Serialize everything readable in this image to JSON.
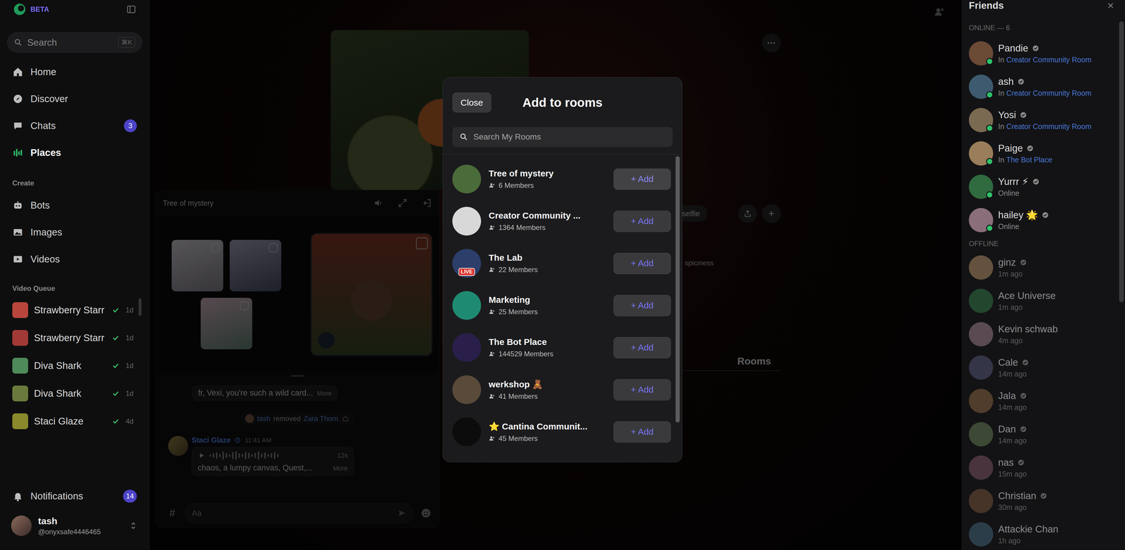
{
  "sidebar": {
    "badge": "BETA",
    "search": {
      "placeholder": "Search",
      "shortcut": "⌘K"
    },
    "nav": [
      {
        "label": "Home",
        "kind": "home",
        "selected": false
      },
      {
        "label": "Discover",
        "kind": "discover",
        "selected": false
      },
      {
        "label": "Chats",
        "kind": "chats",
        "selected": false,
        "count": "3"
      },
      {
        "label": "Places",
        "kind": "places",
        "selected": true
      }
    ],
    "create_title": "Create",
    "create": [
      {
        "label": "Bots",
        "kind": "bots"
      },
      {
        "label": "Images",
        "kind": "images"
      },
      {
        "label": "Videos",
        "kind": "videos"
      }
    ],
    "queue_title": "Video Queue",
    "queue": [
      {
        "name": "Strawberry Starr",
        "done": true,
        "age": "1d",
        "color": "#b8463c"
      },
      {
        "name": "Strawberry Starr",
        "done": true,
        "age": "1d",
        "color": "#a13a36"
      },
      {
        "name": "Diva Shark",
        "done": true,
        "age": "1d",
        "color": "#4f8a5a"
      },
      {
        "name": "Diva Shark",
        "done": true,
        "age": "1d",
        "color": "#6a7a3c"
      },
      {
        "name": "Staci Glaze",
        "done": true,
        "age": "4d",
        "color": "#8a8a2c"
      }
    ],
    "notifications": {
      "label": "Notifications",
      "count": "14"
    },
    "user": {
      "name": "tash",
      "handle": "@onyxsafe4446465"
    }
  },
  "main": {
    "chips": [
      "selfie"
    ],
    "meter_label": "spiciness",
    "section_tab": "Rooms"
  },
  "mini_player": {
    "title": "Tree of mystery",
    "messages": [
      {
        "kind": "bubble",
        "text": "fr, Vexi, you're such a wild card...",
        "more": "More"
      },
      {
        "kind": "system",
        "actor": "tash",
        "action": "removed",
        "target": "Zara Thorn"
      },
      {
        "kind": "audio",
        "author": "Staci Glaze",
        "time": "11:41 AM",
        "duration": "12s",
        "text": "chaos, a lumpy canvas, Quest,...",
        "more": "More"
      }
    ],
    "channel_icon": "#",
    "input_placeholder": "Aa"
  },
  "modal": {
    "close": "Close",
    "title": "Add to rooms",
    "search_placeholder": "Search My Rooms",
    "add_label": "+ Add",
    "rooms": [
      {
        "name": "Tree of mystery",
        "members": "6 Members",
        "hovered": true
      },
      {
        "name": "Creator Community ...",
        "members": "1364 Members",
        "hovered": false
      },
      {
        "name": "The Lab",
        "members": "22 Members",
        "hovered": false,
        "badge": "LIVE"
      },
      {
        "name": "Marketing",
        "members": "25 Members",
        "hovered": false
      },
      {
        "name": "The Bot Place",
        "members": "144529 Members",
        "hovered": false
      },
      {
        "name": "werkshop 🧸",
        "members": "41 Members",
        "hovered": false
      },
      {
        "name": "⭐ Cantina Communit...",
        "members": "45 Members",
        "hovered": false
      }
    ]
  },
  "friends": {
    "title": "Friends",
    "online_label": "ONLINE — 6",
    "offline_label": "OFFLINE",
    "online": [
      {
        "name": "Pandie",
        "verified": true,
        "online": true,
        "status": "In",
        "room": "Creator Community Room"
      },
      {
        "name": "ash",
        "verified": true,
        "online": true,
        "status": "In",
        "room": "Creator Community Room"
      },
      {
        "name": "Yosi",
        "verified": true,
        "online": true,
        "status": "In",
        "room": "Creator Community Room"
      },
      {
        "name": "Paige",
        "verified": true,
        "online": true,
        "status": "In",
        "room": "The Bot Place"
      },
      {
        "name": "Yurrr ⚡",
        "verified": true,
        "online": true,
        "status": "Online"
      },
      {
        "name": "hailey 🌟",
        "verified": true,
        "online": true,
        "status": "Online"
      }
    ],
    "offline": [
      {
        "name": "ginz",
        "verified": true,
        "online": false,
        "status": "1m ago"
      },
      {
        "name": "Ace Universe",
        "verified": false,
        "online": false,
        "status": "1m ago"
      },
      {
        "name": "Kevin schwab",
        "verified": false,
        "online": false,
        "status": "4m ago"
      },
      {
        "name": "Cale",
        "verified": true,
        "online": false,
        "status": "14m ago"
      },
      {
        "name": "Jala",
        "verified": true,
        "online": false,
        "status": "14m ago"
      },
      {
        "name": "Dan",
        "verified": true,
        "online": false,
        "status": "14m ago"
      },
      {
        "name": "nas",
        "verified": true,
        "online": false,
        "status": "15m ago"
      },
      {
        "name": "Christian",
        "verified": true,
        "online": false,
        "status": "30m ago"
      },
      {
        "name": "Attackie Chan",
        "verified": false,
        "online": false,
        "status": "1h ago"
      }
    ]
  }
}
